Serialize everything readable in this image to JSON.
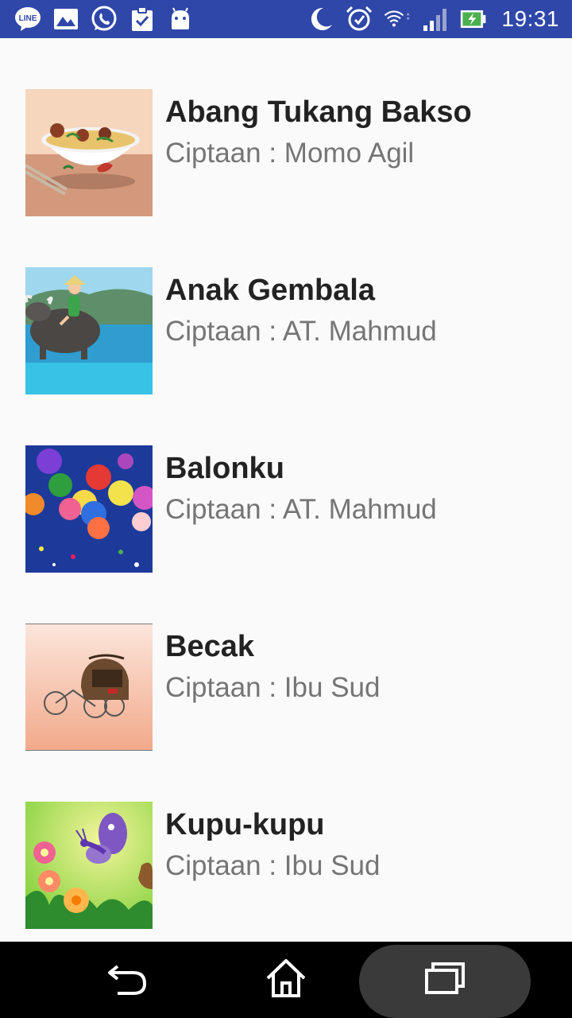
{
  "status_bar": {
    "time": "19:31",
    "left_icons": [
      "line-icon",
      "image-icon",
      "whatsapp-icon",
      "clipboard-icon",
      "android-icon"
    ],
    "right_icons": [
      "moon-icon",
      "alarm-icon",
      "wifi-icon",
      "signal-icon",
      "battery-charging-icon"
    ],
    "line_label": "LINE"
  },
  "songs": [
    {
      "title": "Abang Tukang Bakso",
      "subtitle": "Ciptaan : Momo Agil",
      "thumbnail": "bakso-bowl"
    },
    {
      "title": "Anak Gembala",
      "subtitle": "Ciptaan : AT. Mahmud",
      "thumbnail": "boy-on-buffalo"
    },
    {
      "title": "Balonku",
      "subtitle": "Ciptaan : AT. Mahmud",
      "thumbnail": "balloons"
    },
    {
      "title": "Becak",
      "subtitle": "Ciptaan : Ibu Sud",
      "thumbnail": "becak"
    },
    {
      "title": "Kupu-kupu",
      "subtitle": "Ciptaan : Ibu Sud",
      "thumbnail": "butterfly-flowers"
    }
  ],
  "nav_bar": {
    "buttons": [
      "back-icon",
      "home-icon",
      "recents-icon"
    ]
  }
}
